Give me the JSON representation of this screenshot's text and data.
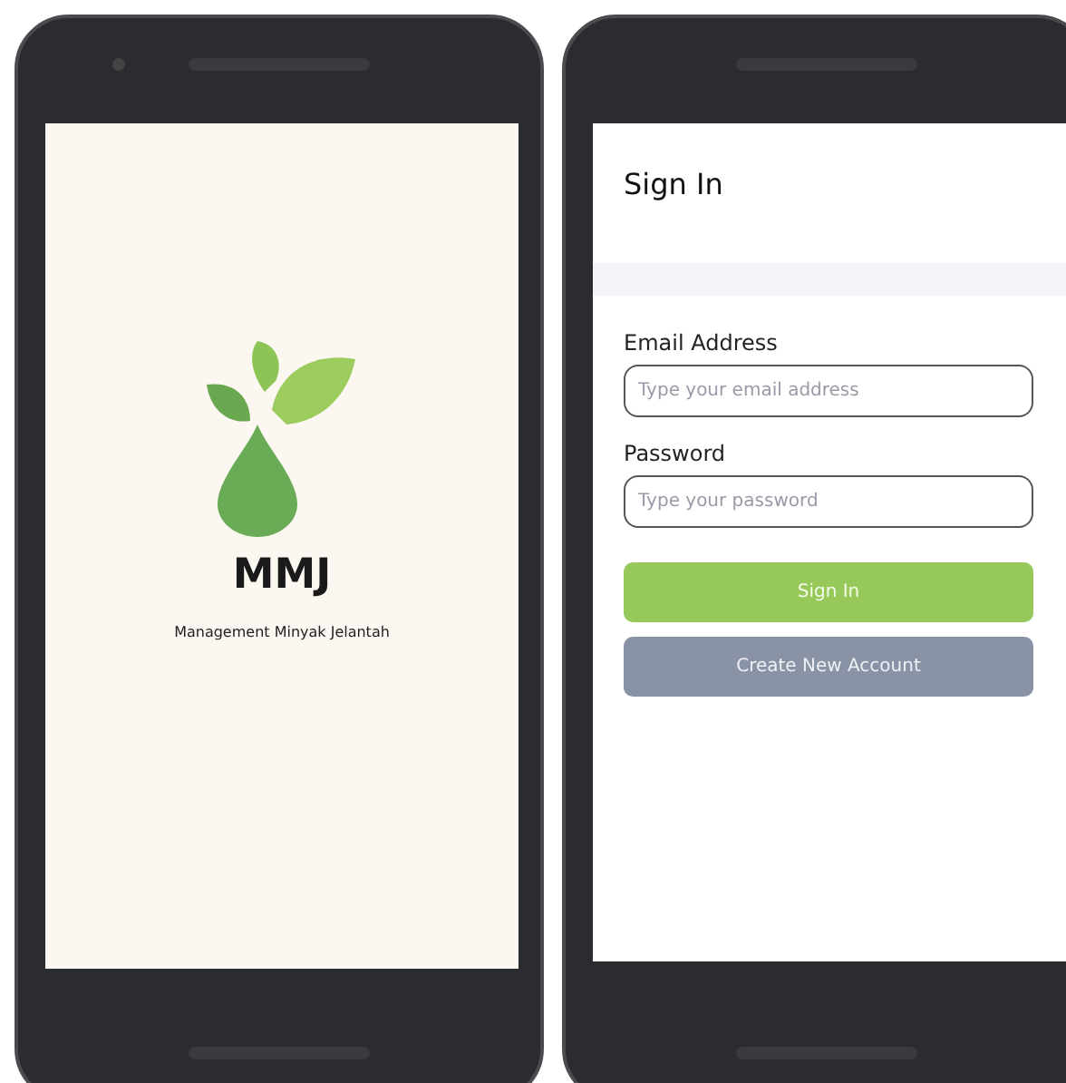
{
  "splash": {
    "title": "MMJ",
    "subtitle": "Management Minyak Jelantah"
  },
  "sign_in": {
    "title": "Sign In",
    "fields": [
      {
        "label": "Email Address",
        "placeholder": "Type your email address"
      },
      {
        "label": "Password",
        "placeholder": "Type your password"
      }
    ],
    "buttons": [
      {
        "label": "Sign In",
        "kind": "primary"
      },
      {
        "label": "Create New Account",
        "kind": "secondary"
      }
    ]
  }
}
